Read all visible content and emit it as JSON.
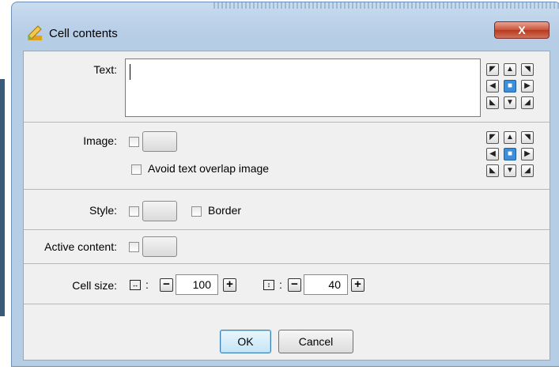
{
  "window": {
    "title": "Cell contents",
    "close_symbol": "X"
  },
  "text_section": {
    "label": "Text:",
    "value": ""
  },
  "image_section": {
    "label": "Image:",
    "avoid_overlap_label": "Avoid text overlap image",
    "avoid_overlap_checked": false
  },
  "style_section": {
    "label": "Style:",
    "border_label": "Border",
    "border_checked": false
  },
  "active_section": {
    "label": "Active content:"
  },
  "cell_size": {
    "label": "Cell size:",
    "width_value": "100",
    "height_value": "40",
    "separator": ":",
    "minus_symbol": "−",
    "plus_symbol": "+"
  },
  "alignment_icons": [
    "arrow-top-left",
    "arrow-up",
    "arrow-top-right",
    "arrow-left",
    "center-square",
    "arrow-right",
    "arrow-bottom-left",
    "arrow-down",
    "arrow-bottom-right"
  ],
  "alignment_selected": "center-square",
  "buttons": {
    "ok": "OK",
    "cancel": "Cancel"
  },
  "colors": {
    "titlebar": "#b6cde6",
    "close": "#c8523a",
    "client": "#f0f0f0",
    "selected_align": "#3d8edb"
  }
}
